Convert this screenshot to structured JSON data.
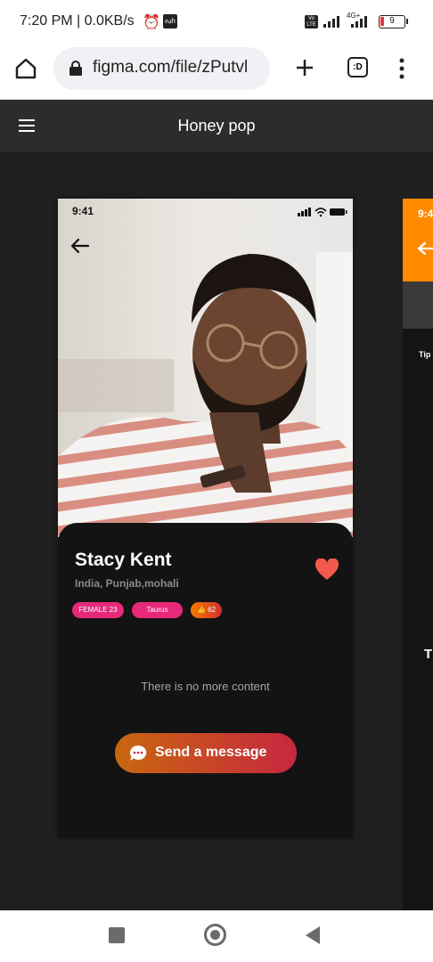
{
  "status_bar": {
    "time": "7:20 PM | 0.0KB/s",
    "small_badge": "ᔓh",
    "volte_badge": "Vo LTE",
    "network": "4G+",
    "battery": "9"
  },
  "browser": {
    "url": "figma.com/file/zPutvl",
    "tab_count": ":D"
  },
  "figma": {
    "title": "Honey pop"
  },
  "frame": {
    "time": "9:41",
    "profile": {
      "name": "Stacy Kent",
      "location": "India, Punjab,mohali",
      "tags": [
        "FEMALE 23",
        "Taurus",
        "62"
      ]
    },
    "empty_text": "There is no more content",
    "send_button": "Send a message"
  },
  "frame2": {
    "time": "9:4",
    "tip": "Tip",
    "partial_char": "T"
  },
  "colors": {
    "accent_orange": "#ff8a00",
    "tag_pink": "#e8297a",
    "heart": "#f25a4b",
    "button_start": "#c8670f",
    "button_end": "#c7273f"
  }
}
